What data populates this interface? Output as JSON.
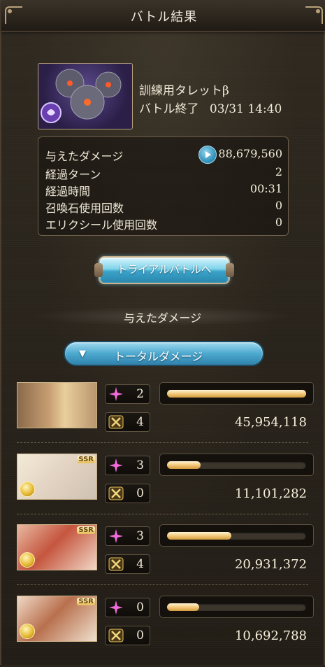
{
  "header": {
    "title": "バトル結果"
  },
  "enemy": {
    "name": "訓練用タレットβ",
    "status": "バトル終了",
    "datetime": "03/31 14:40"
  },
  "stats": [
    {
      "label": "与えたダメージ",
      "value": "88,679,560"
    },
    {
      "label": "経過ターン",
      "value": "2"
    },
    {
      "label": "経過時間",
      "value": "00:31"
    },
    {
      "label": "召喚石使用回数",
      "value": "0"
    },
    {
      "label": "エリクシール使用回数",
      "value": "0"
    }
  ],
  "buttons": {
    "trial": "トライアルバトルへ",
    "total_damage": "トータルダメージ"
  },
  "section_title": "与えたダメージ",
  "characters": [
    {
      "skill_count": "2",
      "ability_count": "4",
      "damage": "45,954,118",
      "bar_fraction": 1.0,
      "rarity": ""
    },
    {
      "skill_count": "3",
      "ability_count": "0",
      "damage": "11,101,282",
      "bar_fraction": 0.24,
      "rarity": "SSR"
    },
    {
      "skill_count": "3",
      "ability_count": "4",
      "damage": "20,931,372",
      "bar_fraction": 0.46,
      "rarity": "SSR"
    },
    {
      "skill_count": "0",
      "ability_count": "0",
      "damage": "10,692,788",
      "bar_fraction": 0.23,
      "rarity": "SSR"
    }
  ],
  "colors": {
    "accent_blue": "#4ea9cf",
    "bar_gold": "#f2c97a",
    "skill_pink": "#f06bd8",
    "ability_gold": "#e8c25a"
  }
}
